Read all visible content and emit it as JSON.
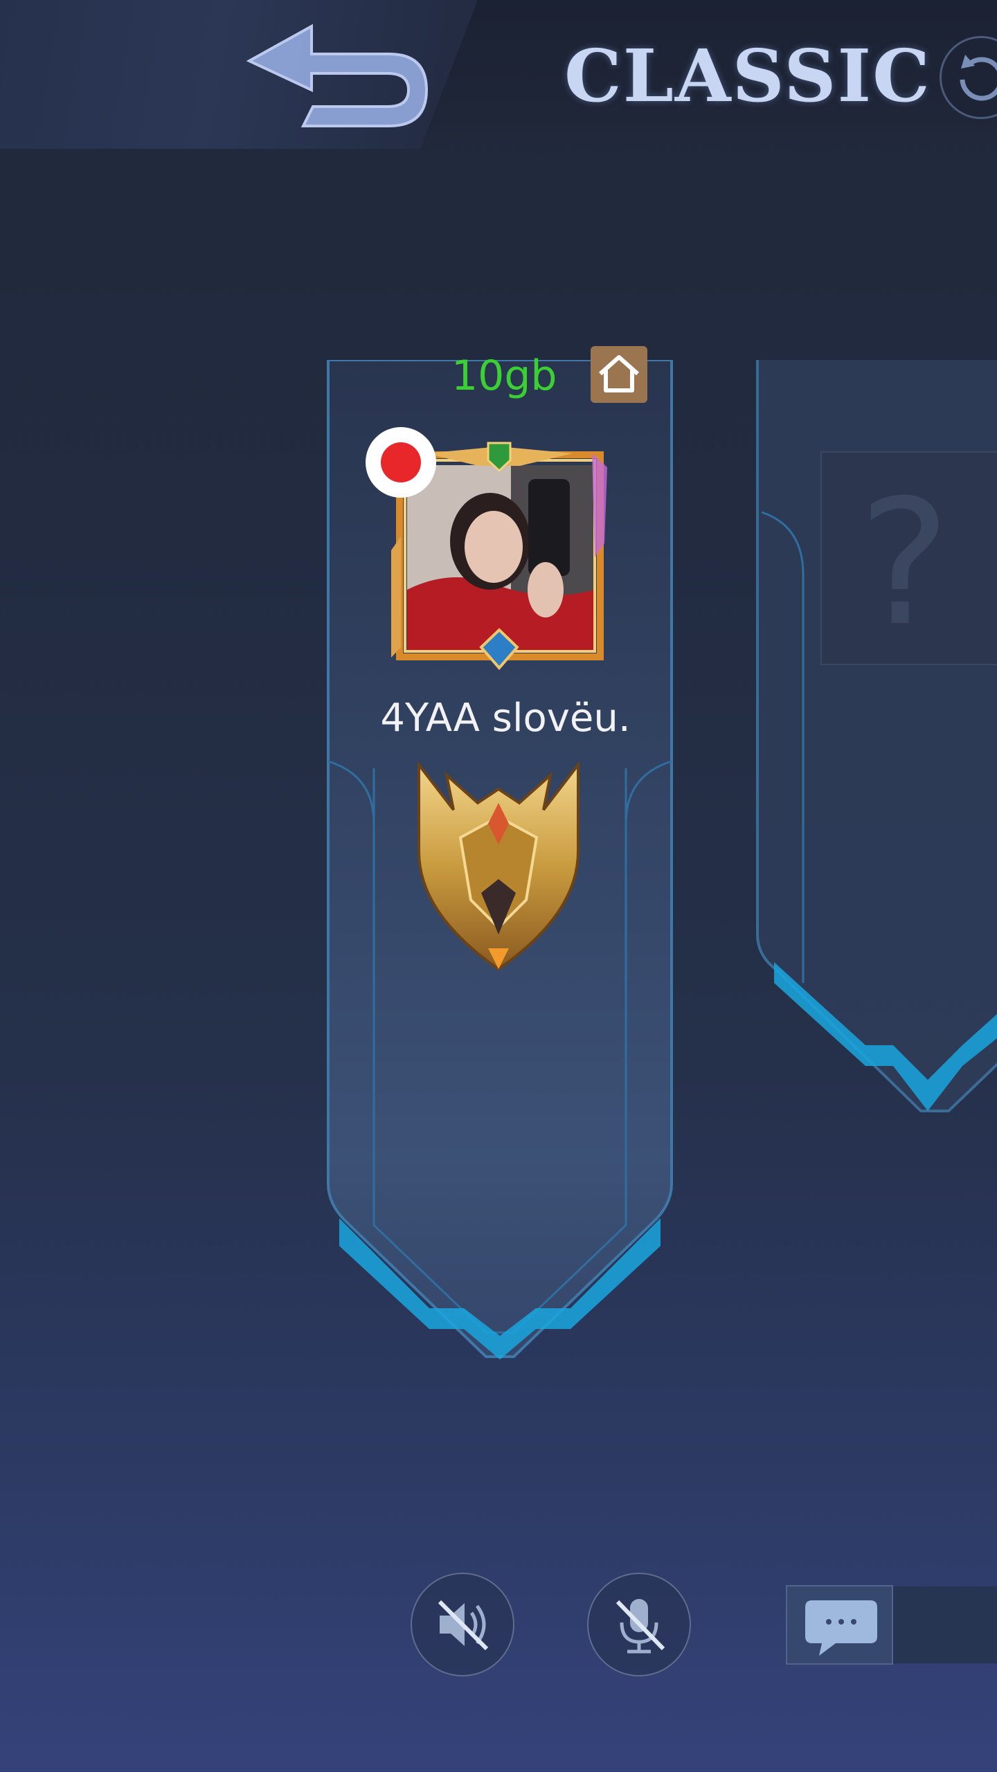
{
  "header": {
    "title": "CLASSIC"
  },
  "player": {
    "status_text": "10gb",
    "name": "4YAA slovëu."
  },
  "slot2": {
    "placeholder": "?"
  },
  "colors": {
    "accent": "#3ccf33",
    "panel_glow": "#1aa6de",
    "record": "#e8272b",
    "home_bg": "#9a7550"
  },
  "icons": {
    "back": "back-arrow-icon",
    "refresh": "refresh-icon",
    "home": "home-icon",
    "record": "record-icon",
    "rank": "rank-badge-icon",
    "speaker_muted": "speaker-muted-icon",
    "mic_muted": "mic-muted-icon",
    "chat": "chat-icon"
  }
}
